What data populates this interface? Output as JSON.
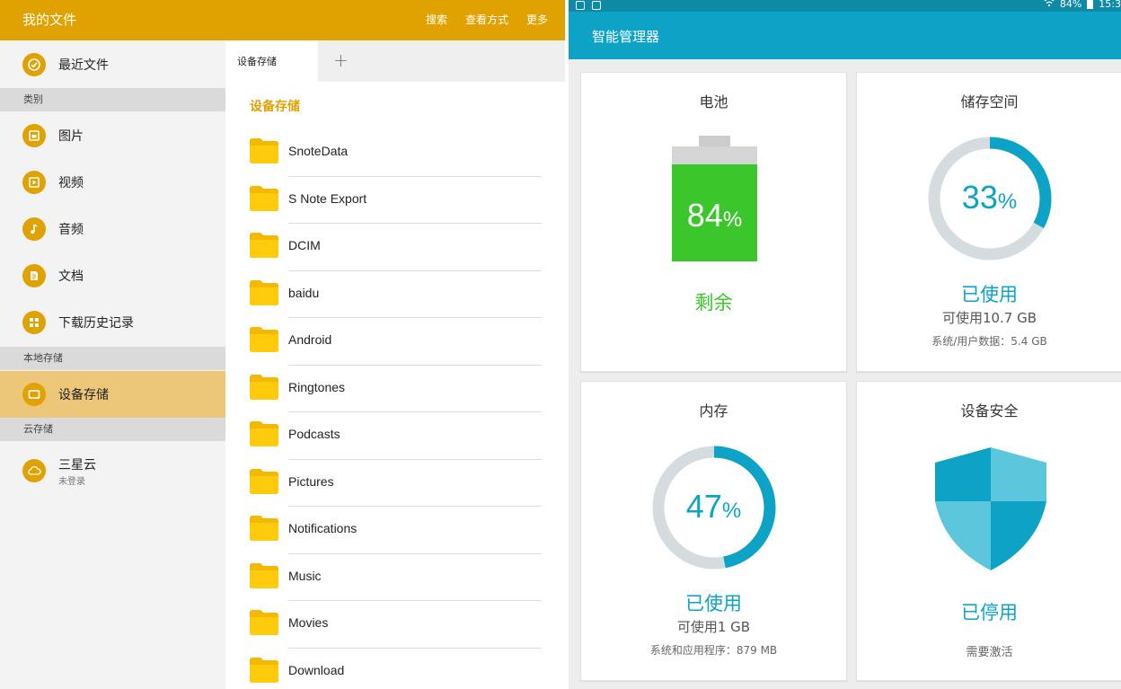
{
  "files_app": {
    "title": "我的文件",
    "actions": [
      "搜索",
      "查看方式",
      "更多"
    ],
    "sidebar": {
      "recent": {
        "label": "最近文件",
        "icon": "clock-icon"
      },
      "sections": {
        "categories": "类别",
        "local": "本地存储",
        "cloud": "云存储"
      },
      "categories": [
        {
          "label": "图片",
          "icon": "image-icon"
        },
        {
          "label": "视频",
          "icon": "video-icon"
        },
        {
          "label": "音频",
          "icon": "music-note-icon"
        },
        {
          "label": "文档",
          "icon": "document-icon"
        },
        {
          "label": "下载历史记录",
          "icon": "download-grid-icon"
        }
      ],
      "local_item": {
        "label": "设备存储",
        "icon": "device-icon"
      },
      "cloud_item": {
        "label": "三星云",
        "sublabel": "未登录",
        "icon": "cloud-icon"
      }
    },
    "tabs": {
      "active": "设备存储",
      "add": "+"
    },
    "breadcrumb": "设备存储",
    "folders": [
      "SnoteData",
      "S Note Export",
      "DCIM",
      "baidu",
      "Android",
      "Ringtones",
      "Podcasts",
      "Pictures",
      "Notifications",
      "Music",
      "Movies",
      "Download"
    ],
    "accent_color": "#e0a200"
  },
  "smart_manager": {
    "status_bar": {
      "battery": "84%",
      "time": "15:3"
    },
    "title": "智能管理器",
    "battery": {
      "title": "电池",
      "percent": "84",
      "unit": "%",
      "level": 0.84,
      "status": "剩余"
    },
    "storage": {
      "title": "储存空间",
      "percent": "33",
      "unit": "%",
      "used_fraction": 0.33,
      "status": "已使用",
      "available": "可使用10.7 GB",
      "detail": "系统/用户数据：5.4 GB"
    },
    "memory": {
      "title": "内存",
      "percent": "47",
      "unit": "%",
      "used_fraction": 0.47,
      "status": "已使用",
      "available": "可使用1 GB",
      "detail": "系统和应用程序：879 MB"
    },
    "security": {
      "title": "设备安全",
      "status": "已停用",
      "detail": "需要激活",
      "icon": "shield-icon"
    },
    "accent_color": "#0da3c6",
    "battery_color": "#3bc62c"
  }
}
